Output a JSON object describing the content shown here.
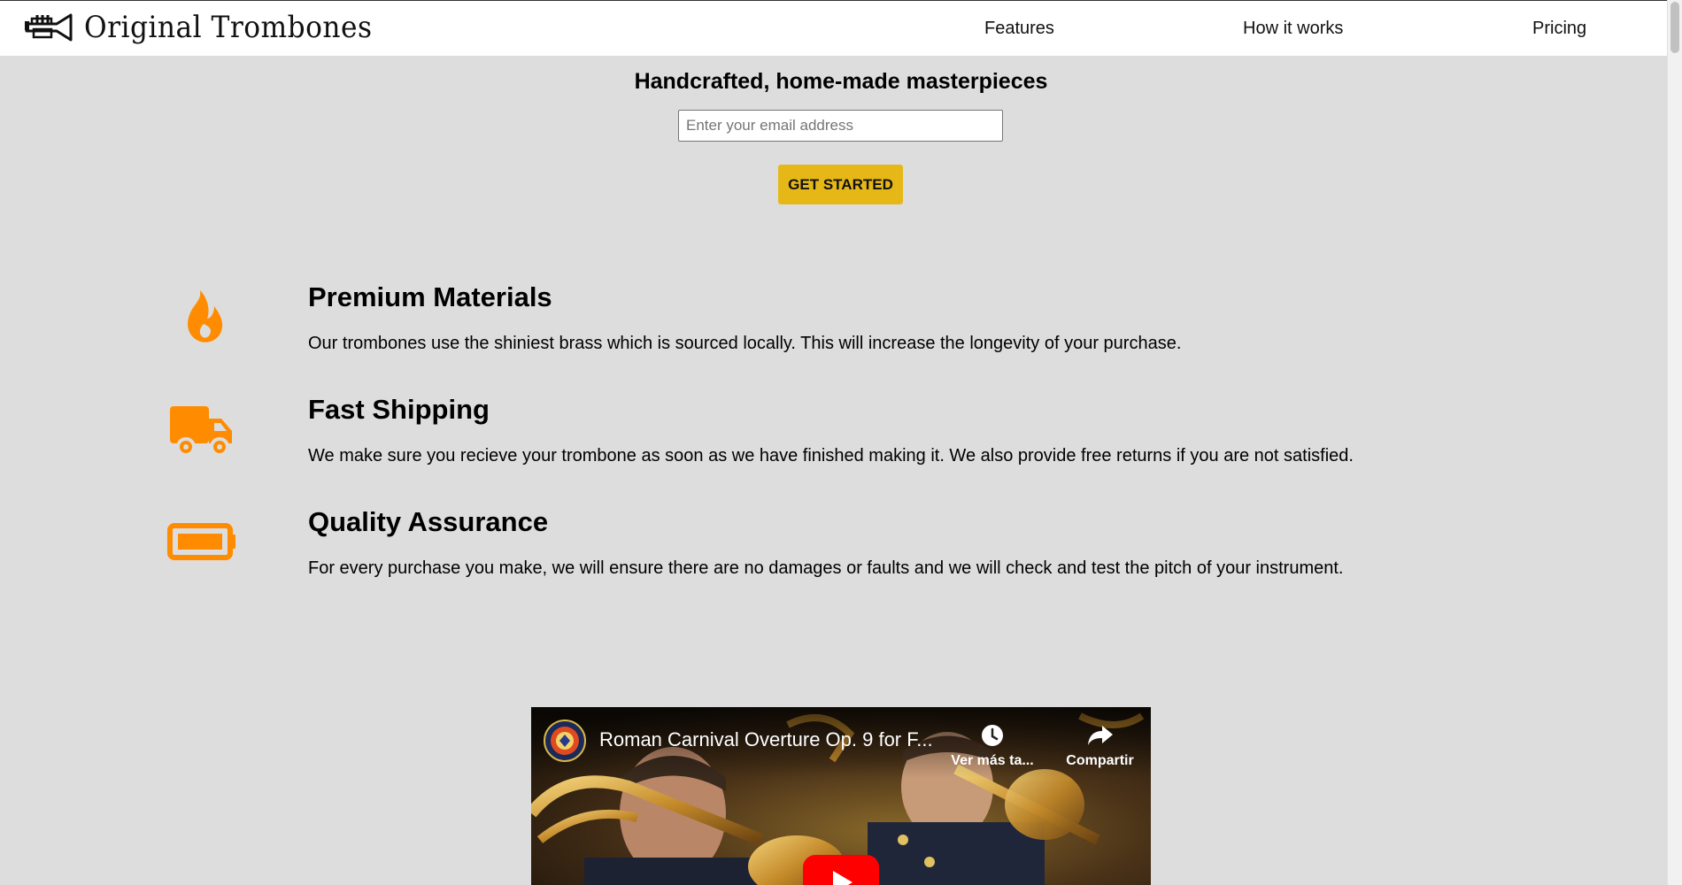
{
  "header": {
    "brand": "Original Trombones",
    "logo_icon": "trumpet-logo-icon",
    "nav": [
      {
        "label": "Features"
      },
      {
        "label": "How it works"
      },
      {
        "label": "Pricing"
      }
    ]
  },
  "hero": {
    "title": "Handcrafted, home-made masterpieces",
    "email_placeholder": "Enter your email address",
    "email_value": "",
    "cta_label": "GET STARTED"
  },
  "features": [
    {
      "icon": "fire-icon",
      "title": "Premium Materials",
      "description": "Our trombones use the shiniest brass which is sourced locally. This will increase the longevity of your purchase."
    },
    {
      "icon": "truck-icon",
      "title": "Fast Shipping",
      "description": "We make sure you recieve your trombone as soon as we have finished making it. We also provide free returns if you are not satisfied."
    },
    {
      "icon": "battery-icon",
      "title": "Quality Assurance",
      "description": "For every purchase you make, we will ensure there are no damages or faults and we will check and test the pitch of your instrument."
    }
  ],
  "video": {
    "title": "Roman Carnival Overture Op. 9 for F...",
    "watch_later_label": "Ver más ta...",
    "share_label": "Compartir"
  },
  "colors": {
    "accent_icon": "#ff8c00",
    "cta_background": "#e6b817",
    "page_background": "#dddddd",
    "header_background": "#ffffff",
    "play_button": "#ff0000"
  }
}
